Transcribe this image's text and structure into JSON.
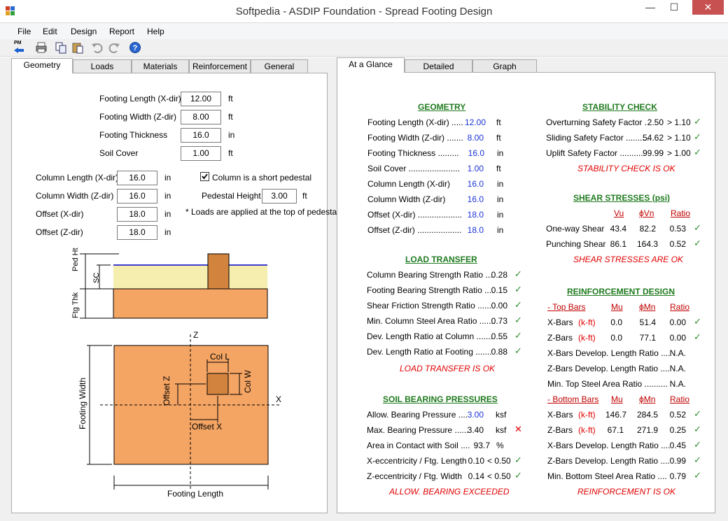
{
  "window": {
    "title": "Softpedia - ASDIP Foundation - Spread Footing Design",
    "minimize": "—",
    "maximize": "☐",
    "close": "✕"
  },
  "menu": [
    {
      "label": "File"
    },
    {
      "label": "Edit"
    },
    {
      "label": "Design"
    },
    {
      "label": "Report"
    },
    {
      "label": "Help"
    }
  ],
  "toolbar": {
    "pm_label": "PM"
  },
  "left_tabs": [
    {
      "label": "Geometry"
    },
    {
      "label": "Loads"
    },
    {
      "label": "Materials"
    },
    {
      "label": "Reinforcement"
    },
    {
      "label": "General"
    }
  ],
  "right_tabs": [
    {
      "label": "At a Glance"
    },
    {
      "label": "Detailed"
    },
    {
      "label": "Graph"
    }
  ],
  "geometry_form": {
    "footing_length_label": "Footing Length (X-dir)",
    "footing_length": "12.00",
    "footing_length_unit": "ft",
    "footing_width_label": "Footing Width (Z-dir)",
    "footing_width": "8.00",
    "footing_width_unit": "ft",
    "footing_thickness_label": "Footing Thickness",
    "footing_thickness": "16.0",
    "footing_thickness_unit": "in",
    "soil_cover_label": "Soil Cover",
    "soil_cover": "1.00",
    "soil_cover_unit": "ft",
    "col_length_label": "Column Length (X-dir)",
    "col_length": "16.0",
    "col_length_unit": "in",
    "col_width_label": "Column Width (Z-dir)",
    "col_width": "16.0",
    "col_width_unit": "in",
    "offset_x_label": "Offset (X-dir)",
    "offset_x": "18.0",
    "offset_x_unit": "in",
    "offset_z_label": "Offset (Z-dir)",
    "offset_z": "18.0",
    "offset_z_unit": "in",
    "short_pedestal_label": "Column is a short pedestal",
    "pedestal_height_label": "Pedestal Height",
    "pedestal_height": "3.00",
    "pedestal_height_unit": "ft",
    "note": "* Loads are applied at the top of pedestal"
  },
  "diagram": {
    "ped_ht": "Ped Ht",
    "sc": "SC",
    "ftg_thk": "Ftg Thk",
    "z": "Z",
    "x": "X",
    "col_l": "Col L",
    "col_w": "Col W",
    "offset_z": "Offset Z",
    "offset_x": "Offset X",
    "footing_width": "Footing Width",
    "footing_length": "Footing Length",
    "footing_color": "#f4a463",
    "soil_color": "#f5eeae",
    "column_color": "#d2843f"
  },
  "glance": {
    "geometry": {
      "title": "GEOMETRY",
      "rows": [
        {
          "label": "Footing Length (X-dir)  .....",
          "value": "12.00",
          "unit": "ft"
        },
        {
          "label": "Footing Width (Z-dir)  .......",
          "value": "8.00",
          "unit": "ft"
        },
        {
          "label": "Footing Thickness  .........",
          "value": "16.0",
          "unit": "in"
        },
        {
          "label": "Soil Cover  ......................",
          "value": "1.00",
          "unit": "ft"
        },
        {
          "label": "Column Length (X-dir)",
          "value": "16.0",
          "unit": "in"
        },
        {
          "label": "Column Width (Z-dir)",
          "value": "16.0",
          "unit": "in"
        },
        {
          "label": "Offset (X-dir)  ...................",
          "value": "18.0",
          "unit": "in"
        },
        {
          "label": "Offset (Z-dir)  ...................",
          "value": "18.0",
          "unit": "in"
        }
      ]
    },
    "load_transfer": {
      "title": "LOAD TRANSFER",
      "rows": [
        {
          "label": "Column Bearing Strength Ratio  ....",
          "value": "0.28"
        },
        {
          "label": "Footing Bearing Strength Ratio  ....",
          "value": "0.15"
        },
        {
          "label": "Shear Friction Strength Ratio  .......",
          "value": "0.00"
        },
        {
          "label": "Min. Column Steel Area Ratio  .......",
          "value": "0.73"
        },
        {
          "label": "Dev. Length Ratio at Column  .......",
          "value": "0.55"
        },
        {
          "label": "Dev. Length Ratio at Footing  .......",
          "value": "0.88"
        }
      ],
      "status": "LOAD TRANSFER IS OK"
    },
    "soil_bearing": {
      "title": "SOIL BEARING PRESSURES",
      "allow_label": "Allow. Bearing Pressure  ....",
      "allow_value": "3.00",
      "allow_unit": "ksf",
      "max_label": "Max. Bearing Pressure  ......",
      "max_value": "3.40",
      "max_unit": "ksf",
      "area_label": "Area in Contact with Soil  ....",
      "area_value": "93.7",
      "area_unit": "%",
      "xecc_label": "X-eccentricity / Ftg. Length",
      "xecc_value": "0.10",
      "xecc_limit": "< 0.50",
      "zecc_label": "Z-eccentricity / Ftg. Width",
      "zecc_value": "0.14",
      "zecc_limit": "< 0.50",
      "status": "ALLOW. BEARING EXCEEDED"
    },
    "stability": {
      "title": "STABILITY CHECK",
      "rows": [
        {
          "label": "Overturning Safety Factor  .",
          "value": "2.50",
          "limit": "> 1.10"
        },
        {
          "label": "Sliding Safety Factor  ..........",
          "value": "54.62",
          "limit": "> 1.10"
        },
        {
          "label": "Uplift Safety Factor  ..........",
          "value": "99.99",
          "limit": "> 1.00"
        }
      ],
      "status": "STABILITY CHECK IS OK"
    },
    "shear": {
      "title": "SHEAR STRESSES (psi)",
      "h_vu": "Vu",
      "h_vn": "ϕVn",
      "h_ratio": "Ratio",
      "rows": [
        {
          "label": "One-way Shear",
          "vu": "43.4",
          "vn": "82.2",
          "ratio": "0.53"
        },
        {
          "label": "Punching Shear",
          "vu": "86.1",
          "vn": "164.3",
          "ratio": "0.52"
        }
      ],
      "status": "SHEAR STRESSES ARE OK"
    },
    "reinforcement": {
      "title": "REINFORCEMENT DESIGN",
      "top_label": "- Top Bars",
      "h_mu": "Mu",
      "h_mn": "ϕMn",
      "h_ratio": "Ratio",
      "kft": "(k-ft)",
      "top_x_label": "X-Bars",
      "top_x_mu": "0.0",
      "top_x_mn": "51.4",
      "top_x_ratio": "0.00",
      "top_z_label": "Z-Bars",
      "top_z_mu": "0.0",
      "top_z_mn": "77.1",
      "top_z_ratio": "0.00",
      "top_xdev_label": "X-Bars Develop. Length Ratio  ....",
      "top_xdev": "N.A.",
      "top_zdev_label": "Z-Bars Develop. Length Ratio  ....",
      "top_zdev": "N.A.",
      "top_min_label": "Min. Top Steel Area Ratio  ..........",
      "top_min": "N.A.",
      "bot_label": "- Bottom Bars",
      "bot_x_label": "X-Bars",
      "bot_x_mu": "146.7",
      "bot_x_mn": "284.5",
      "bot_x_ratio": "0.52",
      "bot_z_label": "Z-Bars",
      "bot_z_mu": "67.1",
      "bot_z_mn": "271.9",
      "bot_z_ratio": "0.25",
      "bot_xdev_label": "X-Bars Develop. Length Ratio  ....",
      "bot_xdev": "0.45",
      "bot_zdev_label": "Z-Bars Develop. Length Ratio  ....",
      "bot_zdev": "0.99",
      "bot_min_label": "Min. Bottom Steel Area Ratio  ....",
      "bot_min": "0.79",
      "status": "REINFORCEMENT IS OK"
    }
  }
}
